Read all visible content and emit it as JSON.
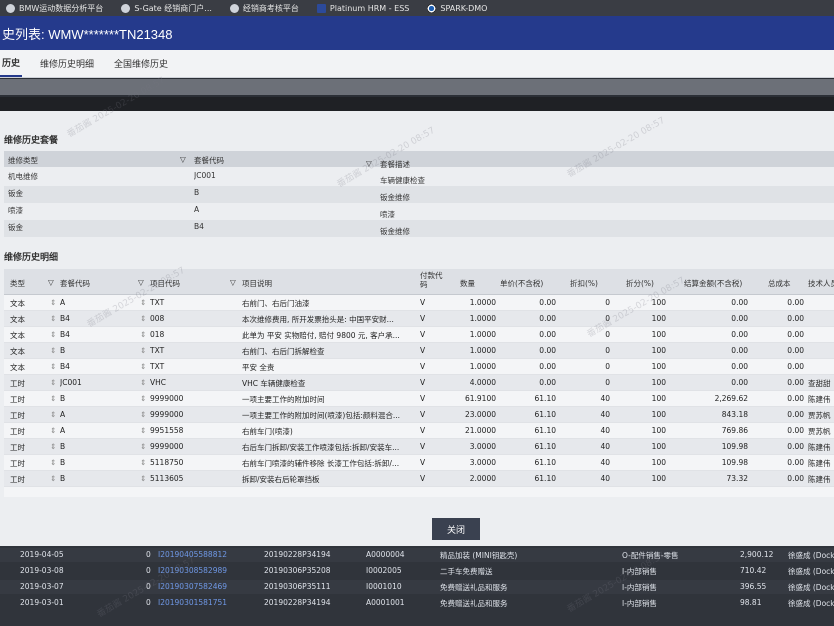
{
  "bookmarks": [
    {
      "label": "BMW运动数据分析平台",
      "icon": "web-icon"
    },
    {
      "label": "S-Gate 经销商门户...",
      "icon": "web-icon"
    },
    {
      "label": "经销商考核平台",
      "icon": "web-icon"
    },
    {
      "label": "Platinum HRM - ESS",
      "icon": "hrm-icon"
    },
    {
      "label": "SPARK-DMO",
      "icon": "bmw-icon"
    }
  ],
  "title": "史列表: WMW*******TN21348",
  "tabs": [
    {
      "label": "历史",
      "active": true
    },
    {
      "label": "维修历史明细",
      "active": false
    },
    {
      "label": "全国维修历史",
      "active": false
    }
  ],
  "package_section": {
    "title": "维修历史套餐",
    "headers": [
      "维修类型",
      "套餐代码",
      "套餐描述"
    ],
    "rows": [
      [
        "机电维修",
        "JC001",
        "车辆健康检查"
      ],
      [
        "钣金",
        "B",
        "钣金维修"
      ],
      [
        "喷漆",
        "A",
        "喷漆"
      ],
      [
        "钣金",
        "B4",
        "钣金维修"
      ]
    ]
  },
  "detail_section": {
    "title": "维修历史明细",
    "headers": [
      "类型",
      "套餐代码",
      "项目代码",
      "项目说明",
      "付款代码",
      "数量",
      "单价(不含税)",
      "折扣(%)",
      "折分(%)",
      "结算金额(不含税)",
      "总成本",
      "技术人员"
    ],
    "rows": [
      [
        "文本",
        "A",
        "TXT",
        "右前门、右后门油漆",
        "V",
        "1.0000",
        "0.00",
        "0",
        "100",
        "0.00",
        "0.00",
        ""
      ],
      [
        "文本",
        "B4",
        "008",
        "本次维修费用, 所开发票抬头是: 中国平安财...",
        "V",
        "1.0000",
        "0.00",
        "0",
        "100",
        "0.00",
        "0.00",
        ""
      ],
      [
        "文本",
        "B4",
        "018",
        "此单为 平安 实物赔付, 赔付 9800 元, 客户承...",
        "V",
        "1.0000",
        "0.00",
        "0",
        "100",
        "0.00",
        "0.00",
        ""
      ],
      [
        "文本",
        "B",
        "TXT",
        "右前门、右后门拆解检查",
        "V",
        "1.0000",
        "0.00",
        "0",
        "100",
        "0.00",
        "0.00",
        ""
      ],
      [
        "文本",
        "B4",
        "TXT",
        "平安 全责",
        "V",
        "1.0000",
        "0.00",
        "0",
        "100",
        "0.00",
        "0.00",
        ""
      ],
      [
        "工时",
        "JC001",
        "VHC",
        "VHC 车辆健康检查",
        "V",
        "4.0000",
        "0.00",
        "0",
        "100",
        "0.00",
        "0.00",
        "查甜甜"
      ],
      [
        "工时",
        "B",
        "9999000",
        "一项主要工作的附加时间",
        "V",
        "61.9100",
        "61.10",
        "40",
        "100",
        "2,269.62",
        "0.00",
        "陈建伟"
      ],
      [
        "工时",
        "A",
        "9999000",
        "一项主要工作的附加时间(喷漆)包括:颜料混合...",
        "V",
        "23.0000",
        "61.10",
        "40",
        "100",
        "843.18",
        "0.00",
        "贾苏帆"
      ],
      [
        "工时",
        "A",
        "9951558",
        "右前车门(喷漆)",
        "V",
        "21.0000",
        "61.10",
        "40",
        "100",
        "769.86",
        "0.00",
        "贾苏帆"
      ],
      [
        "工时",
        "B",
        "9999000",
        "右后车门拆卸/安装工作喷漆包括:拆卸/安装车...",
        "V",
        "3.0000",
        "61.10",
        "40",
        "100",
        "109.98",
        "0.00",
        "陈建伟"
      ],
      [
        "工时",
        "B",
        "5118750",
        "右前车门喷漆的辅件移除 长漆工作包括:拆卸/...",
        "V",
        "3.0000",
        "61.10",
        "40",
        "100",
        "109.98",
        "0.00",
        "陈建伟"
      ],
      [
        "工时",
        "B",
        "5113605",
        "拆卸/安装右后轮罩挡板",
        "V",
        "2.0000",
        "61.10",
        "40",
        "100",
        "73.32",
        "0.00",
        "陈建伟"
      ]
    ]
  },
  "close_label": "关闭",
  "background_rows": [
    [
      "2019-04-05",
      "0",
      "I20190405588812",
      "20190228P34194",
      "A0000004",
      "精品加装 (MINI钥匙壳)",
      "O-配件销售-零售",
      "2,900.12",
      "徐盛成 (Dock"
    ],
    [
      "2019-03-08",
      "0",
      "I20190308582989",
      "20190306P35208",
      "I0002005",
      "二手车免费赠送",
      "I-内部销售",
      "710.42",
      "徐盛成 (Dock"
    ],
    [
      "2019-03-07",
      "0",
      "I20190307582469",
      "20190306P35111",
      "I0001010",
      "免费赠送礼品和服务",
      "I-内部销售",
      "396.55",
      "徐盛成 (Dock"
    ],
    [
      "2019-03-01",
      "0",
      "I20190301581751",
      "20190228P34194",
      "A0001001",
      "免费赠送礼品和服务",
      "I-内部销售",
      "98.81",
      "徐盛成 (Dock"
    ]
  ],
  "watermark": "番茄酱 2025-02-20 08:57"
}
